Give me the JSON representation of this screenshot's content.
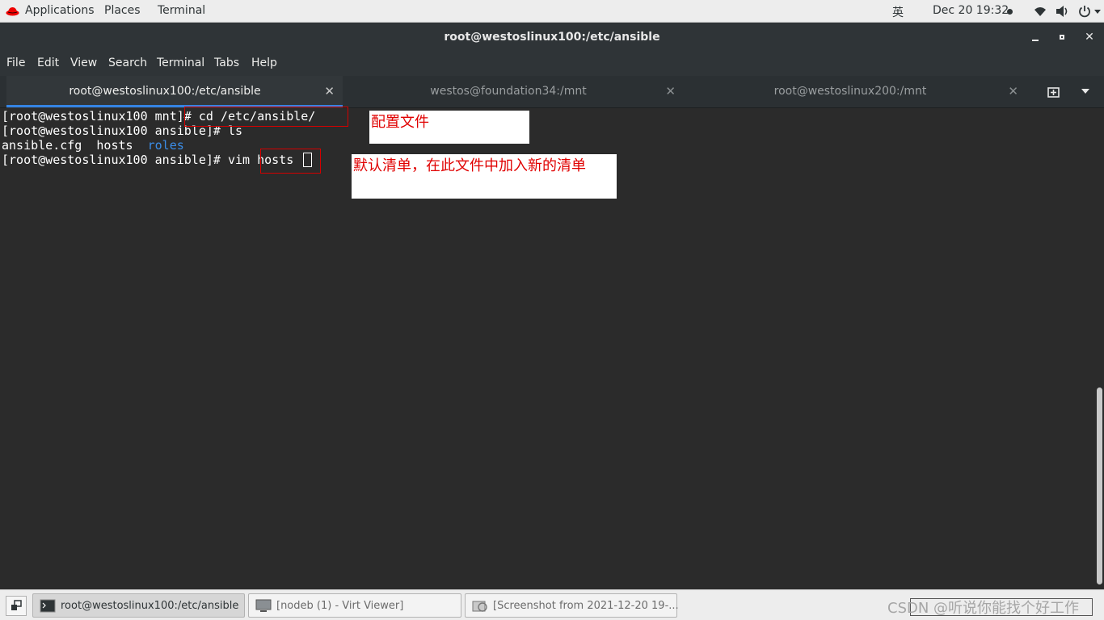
{
  "topbar": {
    "applications": "Applications",
    "places": "Places",
    "terminal": "Terminal",
    "input_method": "英",
    "datetime": "Dec 20  19:32",
    "icons": [
      "redhat-icon",
      "wifi-icon",
      "volume-icon",
      "power-icon"
    ]
  },
  "window": {
    "title": "root@westoslinux100:/etc/ansible"
  },
  "menu": {
    "file": "File",
    "edit": "Edit",
    "view": "View",
    "search": "Search",
    "terminal": "Terminal",
    "tabs": "Tabs",
    "help": "Help"
  },
  "tabs": [
    {
      "label": "root@westoslinux100:/etc/ansible",
      "active": true
    },
    {
      "label": "westos@foundation34:/mnt",
      "active": false
    },
    {
      "label": "root@westoslinux200:/mnt",
      "active": false
    }
  ],
  "terminal": {
    "line1": "[root@westoslinux100 mnt]# cd /etc/ansible/",
    "line2": "[root@westoslinux100 ansible]# ls",
    "line3_files": "ansible.cfg  hosts  ",
    "line3_dir": "roles",
    "line4": "[root@westoslinux100 ansible]# vim hosts "
  },
  "annotations": {
    "note1": "配置文件",
    "note2": "默认清单，在此文件中加入新的清单"
  },
  "taskbar": {
    "items": [
      {
        "label": "root@westoslinux100:/etc/ansible"
      },
      {
        "label": "[nodeb (1) - Virt Viewer]"
      },
      {
        "label": "[Screenshot from 2021-12-20 19-..."
      }
    ],
    "watermark": "CSDN @听说你能找个好工作"
  },
  "colors": {
    "terminal_bg": "#2b2b2b",
    "titlebar_bg": "#2f3437",
    "tab_accent": "#3584e4",
    "directory": "#3b8eea",
    "annotation_red": "#e00000"
  }
}
